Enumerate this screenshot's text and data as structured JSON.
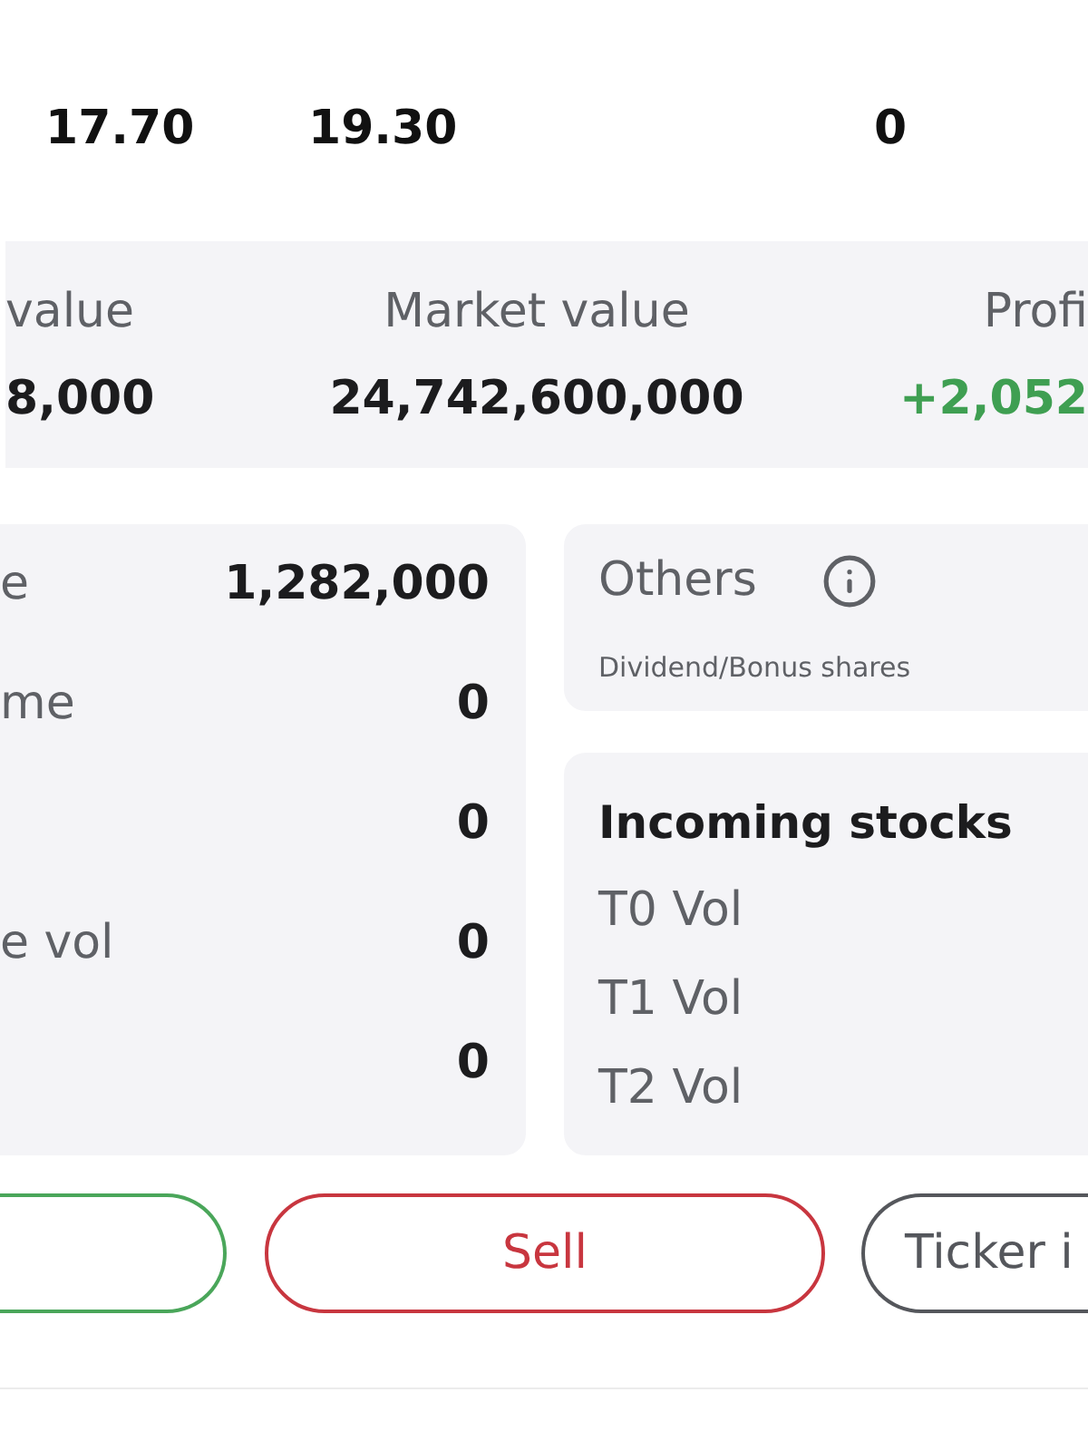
{
  "prices": [
    "17.70",
    "19.30",
    "0"
  ],
  "summary": [
    {
      "label": "value",
      "value": "8,000",
      "kind": "plain"
    },
    {
      "label": "Market value",
      "value": "24,742,600,000",
      "kind": "plain"
    },
    {
      "label": "Profi",
      "value": "+2,052",
      "kind": "gain"
    }
  ],
  "holdings": [
    {
      "label": "e",
      "value": "1,282,000"
    },
    {
      "label": "me",
      "value": "0"
    },
    {
      "value": "0"
    },
    {
      "label": "e vol",
      "value": "0"
    },
    {
      "value": "0"
    }
  ],
  "others": {
    "title": "Others",
    "note": "Dividend/Bonus shares"
  },
  "incoming": {
    "title": "Incoming stocks",
    "rows": [
      "T0 Vol",
      "T1 Vol",
      "T2 Vol"
    ]
  },
  "actions": [
    {
      "kind": "positive"
    },
    {
      "kind": "negative",
      "label": "Sell"
    },
    {
      "kind": "neutral",
      "label": "Ticker i"
    }
  ]
}
